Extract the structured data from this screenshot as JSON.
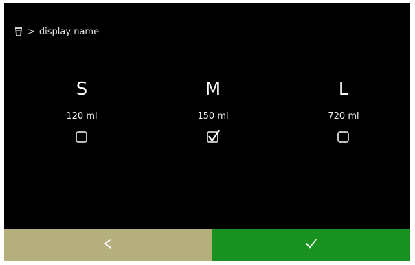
{
  "breadcrumb": {
    "separator": ">",
    "label": "display name",
    "icon": "cup-icon"
  },
  "sizes": [
    {
      "letter": "S",
      "volume": "120 ml",
      "checked": false
    },
    {
      "letter": "M",
      "volume": "150 ml",
      "checked": true
    },
    {
      "letter": "L",
      "volume": "720 ml",
      "checked": false
    }
  ],
  "footer": {
    "back_icon": "chevron-left-icon",
    "confirm_icon": "checkmark-icon",
    "back_color": "#b5ae7d",
    "confirm_color": "#199121"
  }
}
